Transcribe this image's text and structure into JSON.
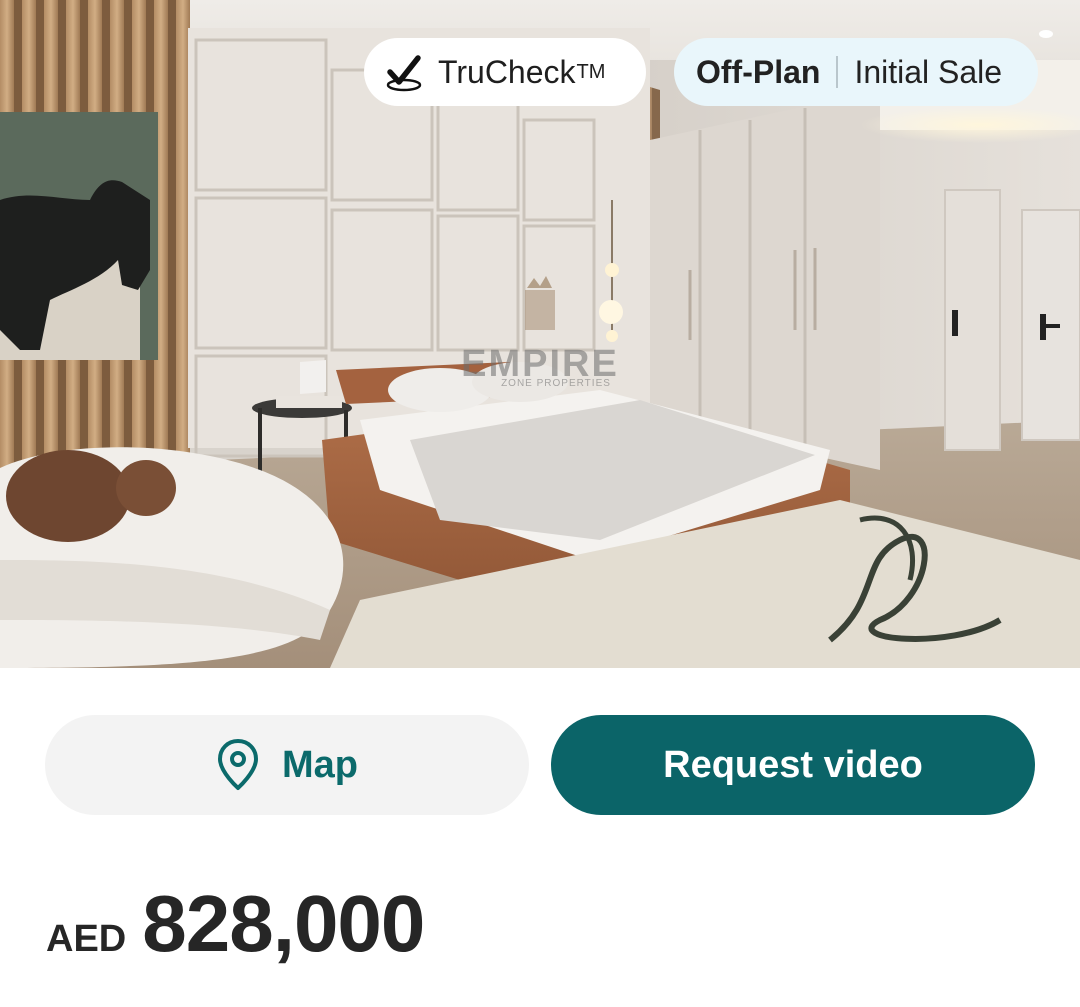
{
  "hero": {
    "image_description_name": "bedroom-photo",
    "badges": {
      "trucheck": {
        "label": "TruCheck",
        "trademark": "TM",
        "icon": "check-icon"
      },
      "status": {
        "primary": "Off-Plan",
        "secondary": "Initial Sale"
      }
    },
    "watermark": {
      "title": "EMPIRE",
      "subtitle": "ZONE PROPERTIES"
    }
  },
  "actions": {
    "map": {
      "label": "Map",
      "icon": "location-pin-icon"
    },
    "request_video": {
      "label": "Request video"
    }
  },
  "price": {
    "currency": "AED",
    "amount": "828,000"
  },
  "colors": {
    "accent": "#0b6468",
    "map_text": "#0b6a6b",
    "status_badge_bg": "#e9f6fb"
  }
}
